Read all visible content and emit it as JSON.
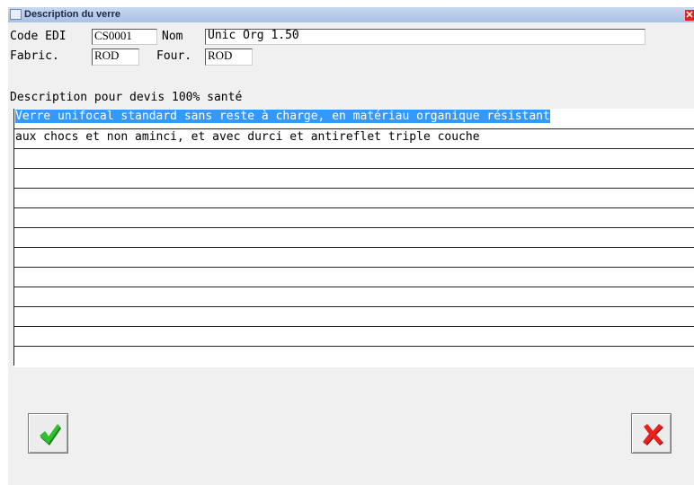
{
  "window": {
    "title": "Description du verre"
  },
  "fields": {
    "code_edi_label": "Code EDI",
    "code_edi_value": "CS0001",
    "nom_label": "Nom",
    "nom_value": "Unic Org 1.50",
    "fabric_label": "Fabric.",
    "fabric_value": "ROD",
    "four_label": "Four.",
    "four_value": "ROD"
  },
  "description": {
    "heading": "Description pour devis 100% santé",
    "lines": [
      "Verre unifocal standard sans reste à charge, en matériau organique résistant",
      "aux chocs et non aminci, et avec durci et antireflet triple couche",
      "",
      "",
      "",
      "",
      "",
      "",
      "",
      "",
      "",
      "",
      ""
    ]
  },
  "buttons": {
    "ok_icon": "green-checkmark-icon",
    "cancel_icon": "red-x-icon"
  },
  "colors": {
    "selection": "#3399ff",
    "ok": "#2aa52a",
    "cancel": "#e8211c"
  }
}
